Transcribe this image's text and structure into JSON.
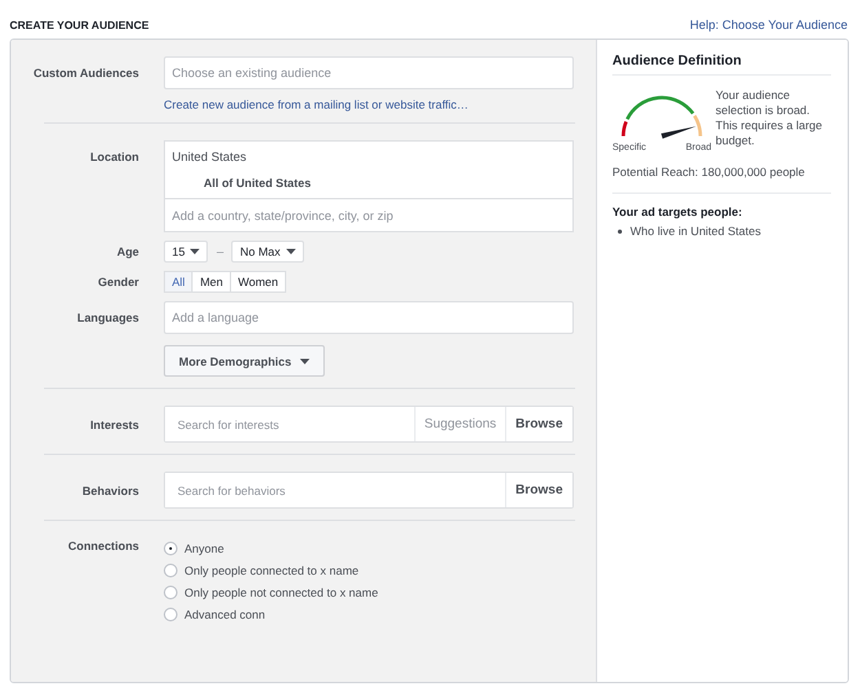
{
  "header": {
    "title": "CREATE YOUR AUDIENCE",
    "help_link": "Help: Choose Your Audience"
  },
  "custom_audiences": {
    "label": "Custom Audiences",
    "placeholder": "Choose an existing audience",
    "link": "Create new audience from a mailing list or website traffic…"
  },
  "demographics": {
    "location": {
      "label": "Location",
      "value": "United States",
      "scope": "All of United States",
      "placeholder": "Add a country, state/province, city, or zip"
    },
    "age": {
      "label": "Age",
      "min": "15",
      "separator": "–",
      "max": "No Max"
    },
    "gender": {
      "label": "Gender",
      "options": [
        {
          "label": "All",
          "selected": true
        },
        {
          "label": "Men",
          "selected": false
        },
        {
          "label": "Women",
          "selected": false
        }
      ]
    },
    "languages": {
      "label": "Languages",
      "placeholder": "Add a language"
    },
    "more_button": "More Demographics"
  },
  "interests": {
    "label": "Interests",
    "placeholder": "Search for interests",
    "suggestions": "Suggestions",
    "browse": "Browse"
  },
  "behaviors": {
    "label": "Behaviors",
    "placeholder": "Search for behaviors",
    "browse": "Browse"
  },
  "connections": {
    "label": "Connections",
    "options": [
      {
        "label": "Anyone",
        "selected": true
      },
      {
        "label": "Only people connected to x name",
        "selected": false
      },
      {
        "label": "Only people not connected to x name",
        "selected": false
      },
      {
        "label": "Advanced conn",
        "selected": false
      }
    ]
  },
  "audience_definition": {
    "title": "Audience Definition",
    "gauge": {
      "min_label": "Specific",
      "max_label": "Broad"
    },
    "description": "Your audience selection is broad. This requires a large budget.",
    "reach": "Potential Reach: 180,000,000 people",
    "targets_title": "Your ad targets people:",
    "targets": [
      "Who live in United States"
    ]
  }
}
